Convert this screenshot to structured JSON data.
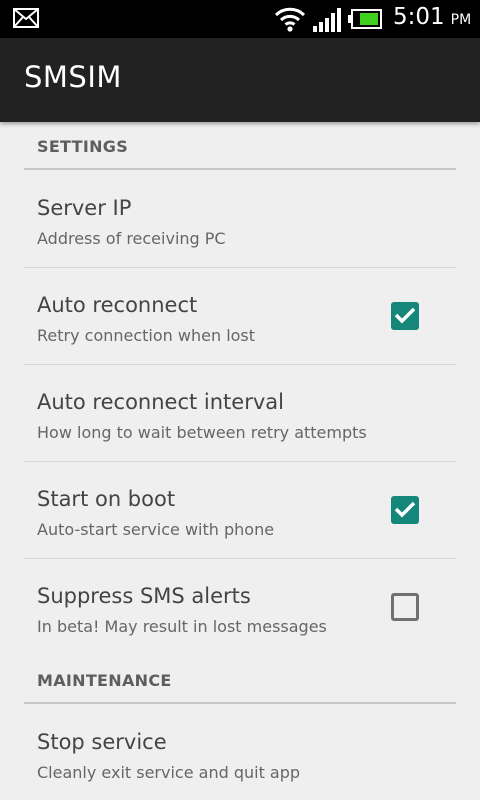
{
  "status_bar": {
    "time": "5:01",
    "ampm": "PM",
    "icons": [
      "mail-icon",
      "wifi-icon",
      "signal-icon",
      "battery-icon"
    ],
    "battery_color": "#3fcf1e"
  },
  "action_bar": {
    "title": "SMSIM"
  },
  "colors": {
    "accent": "#14867a",
    "background": "#efefef",
    "action_bar": "#222222"
  },
  "settings": {
    "category_settings": "SETTINGS",
    "category_maintenance": "MAINTENANCE",
    "items": [
      {
        "title": "Server IP",
        "summary": "Address of receiving PC"
      },
      {
        "title": "Auto reconnect",
        "summary": "Retry connection when lost",
        "checked": true
      },
      {
        "title": "Auto reconnect interval",
        "summary": "How long to wait between retry attempts"
      },
      {
        "title": "Start on boot",
        "summary": "Auto-start service with phone",
        "checked": true
      },
      {
        "title": "Suppress SMS alerts",
        "summary": "In beta! May result in lost messages",
        "checked": false
      },
      {
        "title": "Stop service",
        "summary": "Cleanly exit service and quit app"
      }
    ]
  }
}
